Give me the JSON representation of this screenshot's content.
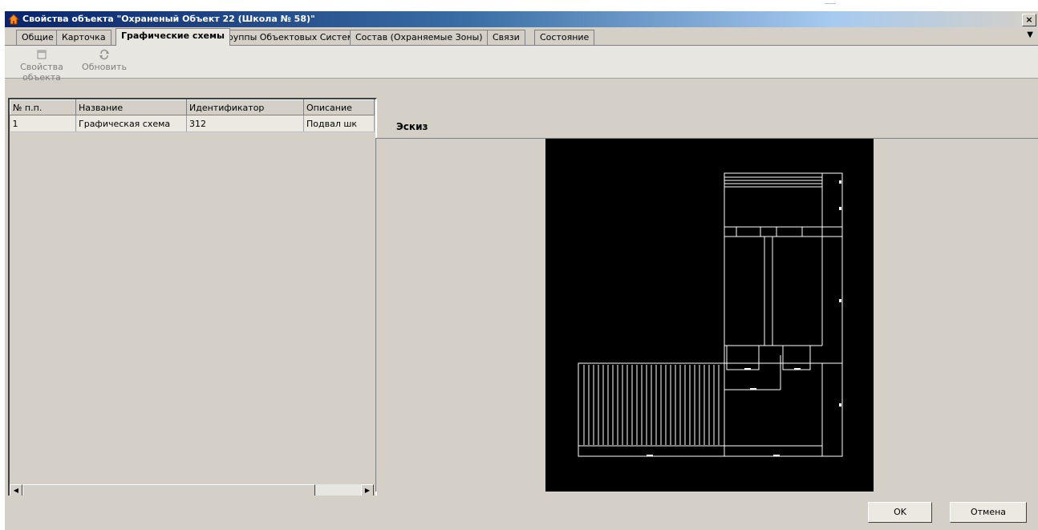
{
  "window": {
    "title": "Свойства объекта \"Охраненый Объект 22 (Школа № 58)\"",
    "close_glyph": "×"
  },
  "tabs": [
    {
      "label": "Общие"
    },
    {
      "label": "Карточка"
    },
    {
      "label": "Графические схемы",
      "active": true
    },
    {
      "label": "Группы Объектовых Систем"
    },
    {
      "label": "Состав (Охраняемые Зоны)"
    },
    {
      "label": "Связи"
    },
    {
      "label": "Состояние"
    }
  ],
  "toolbar": {
    "object_props_label": "Свойства объекта",
    "refresh_label": "Обновить"
  },
  "grid": {
    "columns": [
      "№ п.п.",
      "Название",
      "Идентификатор",
      "Описание"
    ],
    "rows": [
      [
        "1",
        "Графическая схема",
        "312",
        "Подвал шк"
      ]
    ]
  },
  "preview": {
    "label": "Эскиз"
  },
  "footer": {
    "ok_label": "OK",
    "cancel_label": "Отмена"
  },
  "colors": {
    "titlebar_start": "#0a246a",
    "face": "#d4d0c8",
    "sketch_bg": "#000000"
  }
}
